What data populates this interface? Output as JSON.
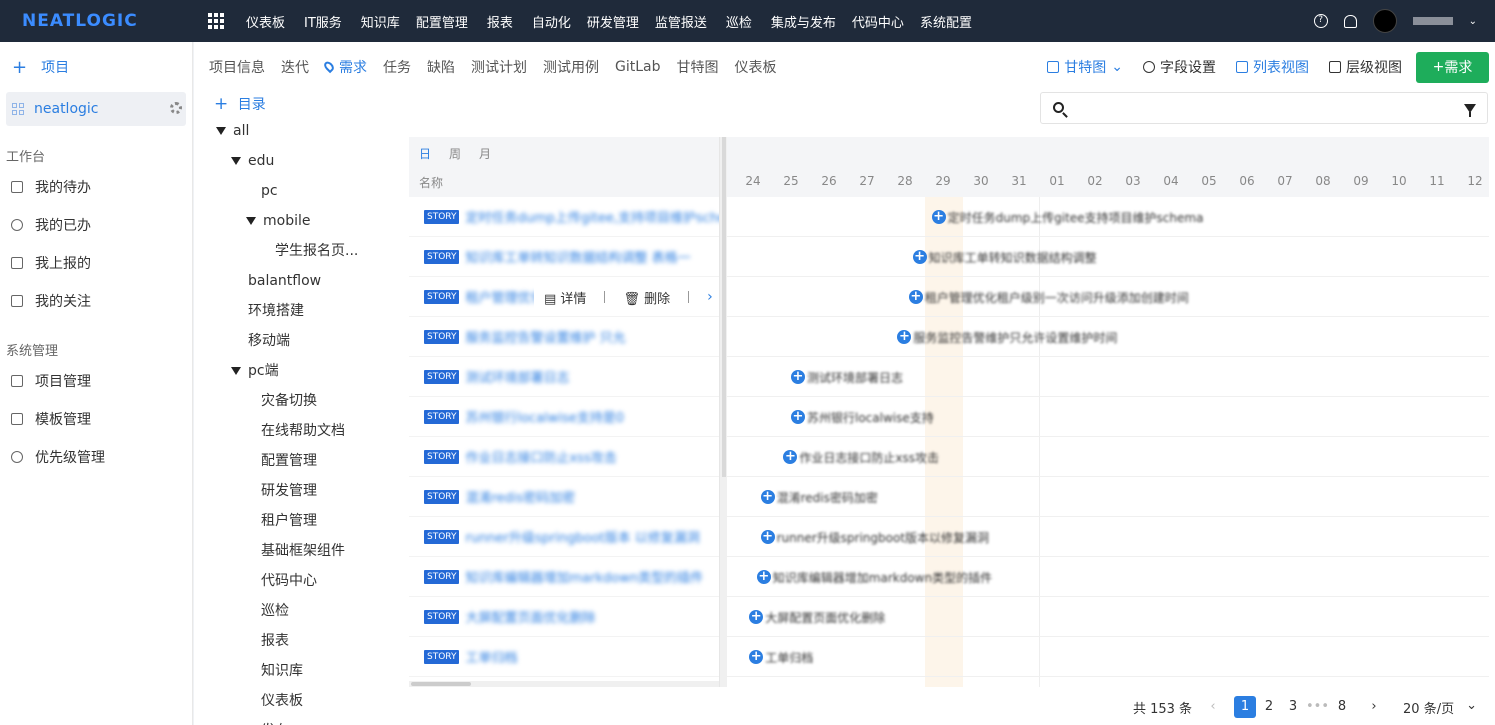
{
  "app": {
    "logo": "NEATLOGIC"
  },
  "topnav": {
    "menu": [
      "仪表板",
      "IT服务",
      "知识库",
      "配置管理",
      "报表",
      "自动化",
      "研发管理",
      "监管报送",
      "巡检",
      "集成与发布",
      "代码中心",
      "系统配置"
    ]
  },
  "sidebar": {
    "add_project": "项目",
    "current_project": "neatlogic",
    "workbench_title": "工作台",
    "workbench": [
      "我的待办",
      "我的已办",
      "我上报的",
      "我的关注"
    ],
    "system_title": "系统管理",
    "system": [
      "项目管理",
      "模板管理",
      "优先级管理"
    ]
  },
  "tabs": [
    "项目信息",
    "迭代",
    "需求",
    "任务",
    "缺陷",
    "测试计划",
    "测试用例",
    "GitLab",
    "甘特图",
    "仪表板"
  ],
  "active_tab": "需求",
  "toolbar": {
    "gantt": "甘特图",
    "fields": "字段设置",
    "list_view": "列表视图",
    "level_view": "层级视图",
    "add_req": "需求"
  },
  "catalog": {
    "add": "目录",
    "nodes": [
      {
        "label": "all",
        "level": 0,
        "expanded": true
      },
      {
        "label": "edu",
        "level": 1,
        "expanded": true
      },
      {
        "label": "pc",
        "level": 2,
        "expanded": null
      },
      {
        "label": "mobile",
        "level": 2,
        "expanded": true
      },
      {
        "label": "学生报名页...",
        "level": 3,
        "expanded": null
      },
      {
        "label": "balantflow",
        "level": 1,
        "expanded": null
      },
      {
        "label": "环境搭建",
        "level": 1,
        "expanded": null
      },
      {
        "label": "移动端",
        "level": 1,
        "expanded": null
      },
      {
        "label": "pc端",
        "level": 1,
        "expanded": true
      },
      {
        "label": "灾备切换",
        "level": 2,
        "expanded": null
      },
      {
        "label": "在线帮助文档",
        "level": 2,
        "expanded": null
      },
      {
        "label": "配置管理",
        "level": 2,
        "expanded": null
      },
      {
        "label": "研发管理",
        "level": 2,
        "expanded": null
      },
      {
        "label": "租户管理",
        "level": 2,
        "expanded": null
      },
      {
        "label": "基础框架组件",
        "level": 2,
        "expanded": null
      },
      {
        "label": "代码中心",
        "level": 2,
        "expanded": null
      },
      {
        "label": "巡检",
        "level": 2,
        "expanded": null
      },
      {
        "label": "报表",
        "level": 2,
        "expanded": null
      },
      {
        "label": "知识库",
        "level": 2,
        "expanded": null
      },
      {
        "label": "仪表板",
        "level": 2,
        "expanded": null
      },
      {
        "label": "发布",
        "level": 2,
        "expanded": null
      }
    ]
  },
  "gantt": {
    "scales": [
      "日",
      "周",
      "月"
    ],
    "active_scale": "日",
    "name_header": "名称",
    "days": [
      "24",
      "25",
      "26",
      "27",
      "28",
      "29",
      "30",
      "31",
      "01",
      "02",
      "03",
      "04",
      "05",
      "06",
      "07",
      "08",
      "09",
      "10",
      "11",
      "12"
    ],
    "today_index": 5,
    "badge": "STORY",
    "hover_ops": {
      "detail": "详情",
      "delete": "删除"
    },
    "rows": [
      {
        "title": "定时任务dump上传gitee,支持项目维护schema",
        "bar": "定时任务dump上传gitee支持项目维护schema",
        "start_day": 5.2
      },
      {
        "title": "知识库工单转知识数据结构调整 表格一",
        "bar": "知识库工单转知识数据结构调整",
        "start_day": 4.7
      },
      {
        "title": "租户管理优化",
        "bar": "租户管理优化租户级别一次访问升级添加创建时间",
        "start_day": 4.6
      },
      {
        "title": "服务监控告警设置维护 只允",
        "bar": "服务监控告警维护只允许设置维护时间",
        "start_day": 4.3
      },
      {
        "title": "测试环境部署日志",
        "bar": "测试环境部署日志",
        "start_day": 1.5
      },
      {
        "title": "苏州银行localwise支持是0",
        "bar": "苏州银行localwise支持",
        "start_day": 1.5
      },
      {
        "title": "作业日志接口防止xss攻击",
        "bar": "作业日志接口防止xss攻击",
        "start_day": 1.3
      },
      {
        "title": "混淆redis密码加密",
        "bar": "混淆redis密码加密",
        "start_day": 0.7
      },
      {
        "title": "runner升级springboot版本 以修复漏洞",
        "bar": "runner升级springboot版本以修复漏洞",
        "start_day": 0.7
      },
      {
        "title": "知识库编辑器增加markdown类型的插件",
        "bar": "知识库编辑器增加markdown类型的插件",
        "start_day": 0.6
      },
      {
        "title": "大屏配置页面优化删除",
        "bar": "大屏配置页面优化删除",
        "start_day": 0.4
      },
      {
        "title": "工单归档",
        "bar": "工单归档",
        "start_day": 0.4
      }
    ]
  },
  "pagination": {
    "total": "共 153 条",
    "pages": [
      "1",
      "2",
      "3",
      "•••",
      "8"
    ],
    "current": "1",
    "page_size": "20 条/页"
  },
  "colors": {
    "nav_bg": "#1f2a3a",
    "accent": "#2b7ee1",
    "add_button": "#1ead5b",
    "badge": "#2469d6"
  }
}
